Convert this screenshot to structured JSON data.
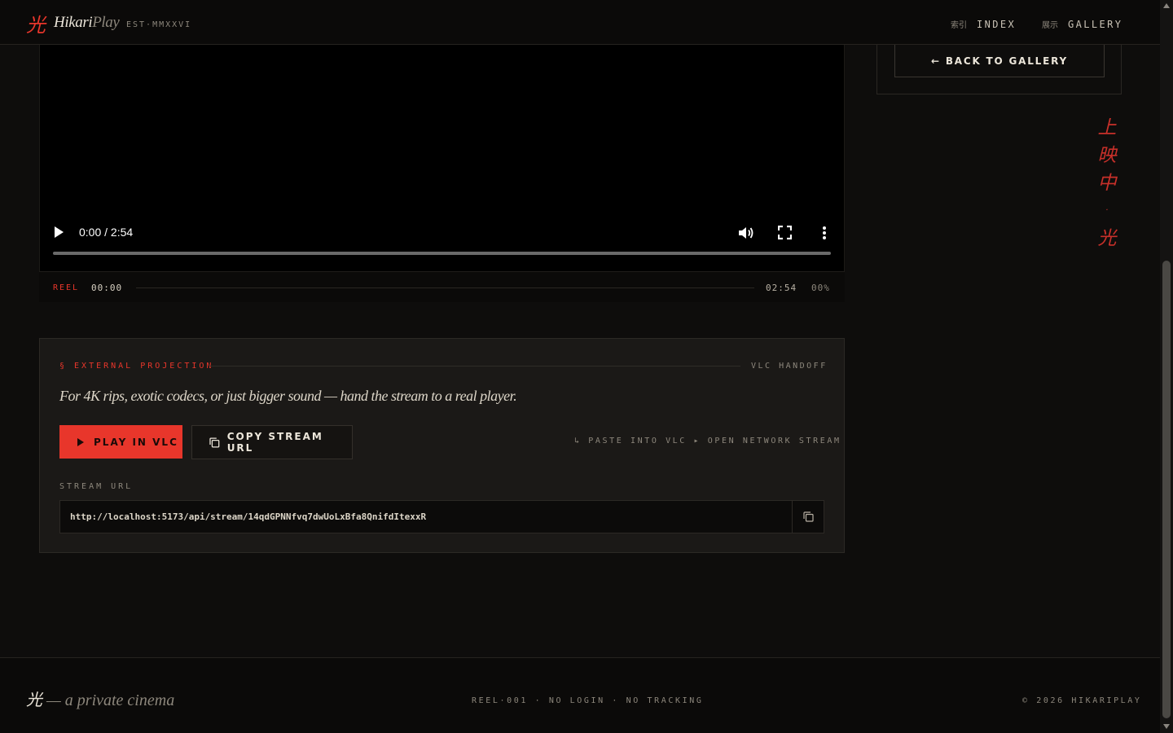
{
  "header": {
    "logo_kanji": "光",
    "logo_name_main": "Hikari",
    "logo_name_sub": "Play",
    "est": "EST·MMXXVI",
    "nav": [
      {
        "kanji": "索引",
        "label": "INDEX"
      },
      {
        "kanji": "展示",
        "label": "GALLERY"
      }
    ]
  },
  "video": {
    "time": "0:00 / 2:54",
    "progress": 0,
    "play_icon": "play-icon",
    "volume_icon": "volume-icon",
    "fullscreen_icon": "fullscreen-icon",
    "more_icon": "more-vertical-icon"
  },
  "reel": {
    "label": "REEL",
    "current": "00:00",
    "total": "02:54",
    "percent": "00%"
  },
  "side": {
    "back_label": "← BACK TO GALLERY",
    "vertical_kanji": [
      "上",
      "映",
      "中",
      "·",
      "光"
    ]
  },
  "external": {
    "heading": "§ EXTERNAL PROJECTION",
    "tag": "VLC HANDOFF",
    "description": "For 4K rips, exotic codecs, or just bigger sound — hand the stream to a real player.",
    "play_vlc_label": "PLAY IN VLC",
    "copy_url_label": "COPY STREAM URL",
    "hint": "↳ PASTE INTO VLC ▸ OPEN NETWORK STREAM",
    "url_label": "STREAM URL",
    "url": "http://localhost:5173/api/stream/14qdGPNNfvq7dwUoLxBfa8QnifdItexxR"
  },
  "footer": {
    "logo_kanji": "光",
    "tagline": " — a private cinema",
    "middle": "REEL·001 · NO LOGIN · NO TRACKING",
    "copyright": "© 2026 HIKARIPLAY"
  },
  "colors": {
    "accent": "#e8362b",
    "background": "#0e0d0c",
    "panel": "#1b1917",
    "text": "#e8e2d6",
    "muted": "#8d877c"
  }
}
